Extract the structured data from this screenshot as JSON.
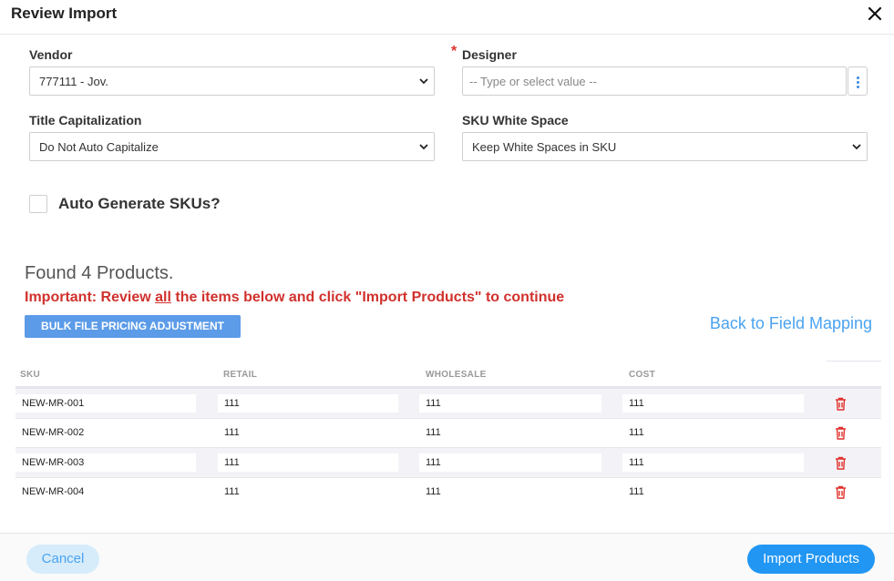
{
  "dialog": {
    "title": "Review Import"
  },
  "form": {
    "vendor": {
      "label": "Vendor",
      "value": "777111 - Jov."
    },
    "designer": {
      "label": "Designer",
      "placeholder": "-- Type or select value --",
      "required_mark": "*"
    },
    "title_capitalization": {
      "label": "Title Capitalization",
      "value": "Do Not Auto Capitalize"
    },
    "sku_white_space": {
      "label": "SKU White Space",
      "value": "Keep White Spaces in SKU"
    },
    "auto_generate": {
      "label": "Auto Generate SKUs?",
      "checked": false
    }
  },
  "summary": {
    "found": "Found 4 Products.",
    "important_pre": "Important: Review ",
    "important_em": "all",
    "important_post": " the items below and click \"Import Products\" to continue",
    "bulk_button": "BULK FILE PRICING ADJUSTMENT",
    "back_link": "Back to Field Mapping"
  },
  "table": {
    "headers": [
      "SKU",
      "RETAIL",
      "WHOLESALE",
      "COST"
    ],
    "rows": [
      [
        "NEW-MR-001",
        "111",
        "111",
        "111"
      ],
      [
        "NEW-MR-002",
        "111",
        "111",
        "111"
      ],
      [
        "NEW-MR-003",
        "111",
        "111",
        "111"
      ],
      [
        "NEW-MR-004",
        "111",
        "111",
        "111"
      ]
    ]
  },
  "footer": {
    "cancel": "Cancel",
    "import": "Import Products"
  },
  "colors": {
    "accent": "#2196f3",
    "link": "#4ba3f0",
    "danger": "#d0312d",
    "bulk": "#5b9be8"
  }
}
